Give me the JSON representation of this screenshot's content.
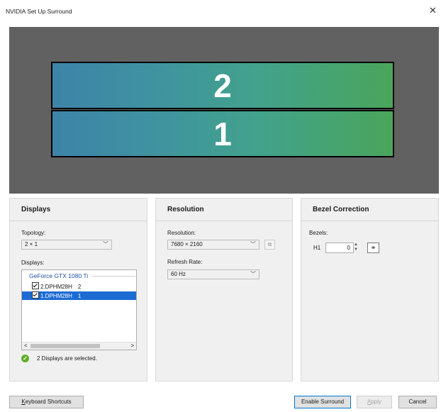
{
  "window": {
    "title": "NVIDIA Set Up Surround",
    "close_glyph": "✕"
  },
  "preview": {
    "monitor_top_label": "2",
    "monitor_bottom_label": "1"
  },
  "displays": {
    "heading": "Displays",
    "topology_label": "Topology:",
    "topology_value": "2 × 1",
    "list_label": "Displays:",
    "gpu_name": "GeForce GTX 1080 Ti",
    "items": [
      {
        "name": "2.DPHM28H",
        "index": "2",
        "checked": true,
        "selected": false
      },
      {
        "name": "1.DPHM28H",
        "index": "1",
        "checked": true,
        "selected": true
      }
    ],
    "status_text": "2 Displays are selected."
  },
  "resolution": {
    "heading": "Resolution",
    "resolution_label": "Resolution:",
    "resolution_value": "7680 × 2160",
    "refresh_label": "Refresh Rate:",
    "refresh_value": "60 Hz"
  },
  "bezel": {
    "heading": "Bezel Correction",
    "bezels_label": "Bezels:",
    "h1_label": "H1",
    "h1_value": "0"
  },
  "footer": {
    "keyboard_shortcuts_prefix": "K",
    "keyboard_shortcuts_rest": "eyboard Shortcuts",
    "enable_surround": "Enable Surround",
    "apply_prefix": "A",
    "apply_rest": "pply",
    "cancel": "Cancel"
  },
  "icons": {
    "close": "close-icon",
    "chevron": "chevron-down-icon",
    "check": "check-icon",
    "link": "link-icon",
    "identify": "identify-display-icon"
  }
}
